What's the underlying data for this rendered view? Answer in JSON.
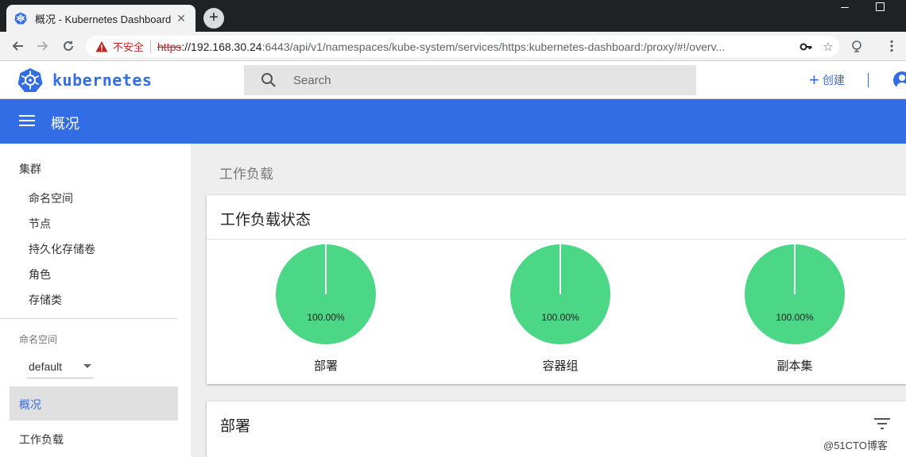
{
  "browser": {
    "tab_title": "概况 - Kubernetes Dashboard",
    "security_label": "不安全",
    "url_protocol": "https",
    "url_host": "://192.168.30.24",
    "url_rest": ":6443/api/v1/namespaces/kube-system/services/https:kubernetes-dashboard:/proxy/#!/overv..."
  },
  "header": {
    "brand": "kubernetes",
    "search_placeholder": "Search",
    "create_label": "创建"
  },
  "topbar": {
    "title": "概况"
  },
  "sidebar": {
    "cluster_heading": "集群",
    "cluster_items": [
      "命名空间",
      "节点",
      "持久化存储卷",
      "角色",
      "存储类"
    ],
    "namespace_label": "命名空间",
    "namespace_value": "default",
    "overview_label": "概况",
    "workloads_label": "工作负载"
  },
  "main": {
    "section_title": "工作负载",
    "status_card_title": "工作负载状态",
    "deployments_card_title": "部署"
  },
  "chart_data": {
    "type": "pie",
    "charts": [
      {
        "label": "部署",
        "value_text": "100.00%",
        "running_fraction": 1.0
      },
      {
        "label": "容器组",
        "value_text": "100.00%",
        "running_fraction": 1.0
      },
      {
        "label": "副本集",
        "value_text": "100.00%",
        "running_fraction": 1.0
      }
    ]
  },
  "colors": {
    "accent": "#326de6",
    "pie_success": "#4cd787"
  },
  "watermark": "@51CTO博客"
}
